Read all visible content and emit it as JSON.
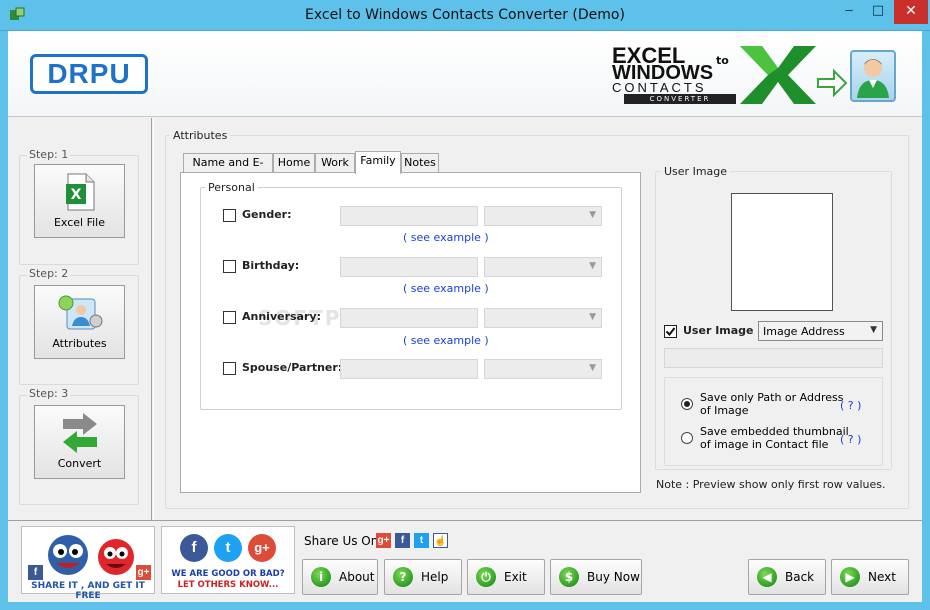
{
  "window": {
    "title": "Excel to Windows Contacts Converter (Demo)",
    "minimize": "‒",
    "maximize": "□",
    "close": "✕"
  },
  "banner": {
    "logo_text": "DRPU",
    "product_line1": "EXCEL",
    "product_to": "to",
    "product_line2": "WINDOWS",
    "product_line3": "CONTACTS",
    "product_line4": "CONVERTER"
  },
  "steps": [
    {
      "step_label": "Step: 1",
      "button_label": "Excel File",
      "icon": "excel-icon"
    },
    {
      "step_label": "Step:  2",
      "button_label": "Attributes",
      "icon": "attributes-icon"
    },
    {
      "step_label": "Step: 3",
      "button_label": "Convert",
      "icon": "convert-arrows-icon"
    }
  ],
  "attributes": {
    "group_label": "Attributes",
    "tabs": [
      "Name and E-mail",
      "Home",
      "Work",
      "Family",
      "Notes"
    ],
    "active_tab": "Family",
    "personal_group": "Personal",
    "fields": [
      {
        "label": "Gender:",
        "checked": false,
        "text_value": "",
        "combo_value": "",
        "example_link": "( see example )"
      },
      {
        "label": "Birthday:",
        "checked": false,
        "text_value": "",
        "combo_value": "",
        "example_link": "( see example )"
      },
      {
        "label": "Anniversary:",
        "checked": false,
        "text_value": "",
        "combo_value": "",
        "example_link": "( see example )"
      },
      {
        "label": "Spouse/Partner:",
        "checked": false,
        "text_value": "",
        "combo_value": ""
      }
    ],
    "watermark": "SOFTPEDIA"
  },
  "user_image": {
    "group_label": "User Image",
    "checkbox_label": "User Image",
    "checked": true,
    "combo_value": "Image Address",
    "path_value": "",
    "radio_options": [
      {
        "line1": "Save only Path or Address",
        "line2": "of Image",
        "selected": true,
        "help": "( ? )"
      },
      {
        "line1": "Save embedded thumbnail",
        "line2": "of image in Contact file",
        "selected": false,
        "help": "( ? )"
      }
    ],
    "note": "Note : Preview show only first row values."
  },
  "footer": {
    "promo1_text": "SHARE IT , AND GET IT FREE",
    "promo2_line1": "WE ARE GOOD OR BAD?",
    "promo2_line2": "LET OTHERS KNOW...",
    "share_label": "Share Us On :",
    "buttons": {
      "about": "About",
      "help": "Help",
      "exit": "Exit",
      "buy_now": "Buy Now",
      "back": "Back",
      "next": "Next"
    },
    "colors": {
      "facebook": "#3b5998",
      "twitter": "#1da1f2",
      "google": "#dd4b39"
    }
  }
}
